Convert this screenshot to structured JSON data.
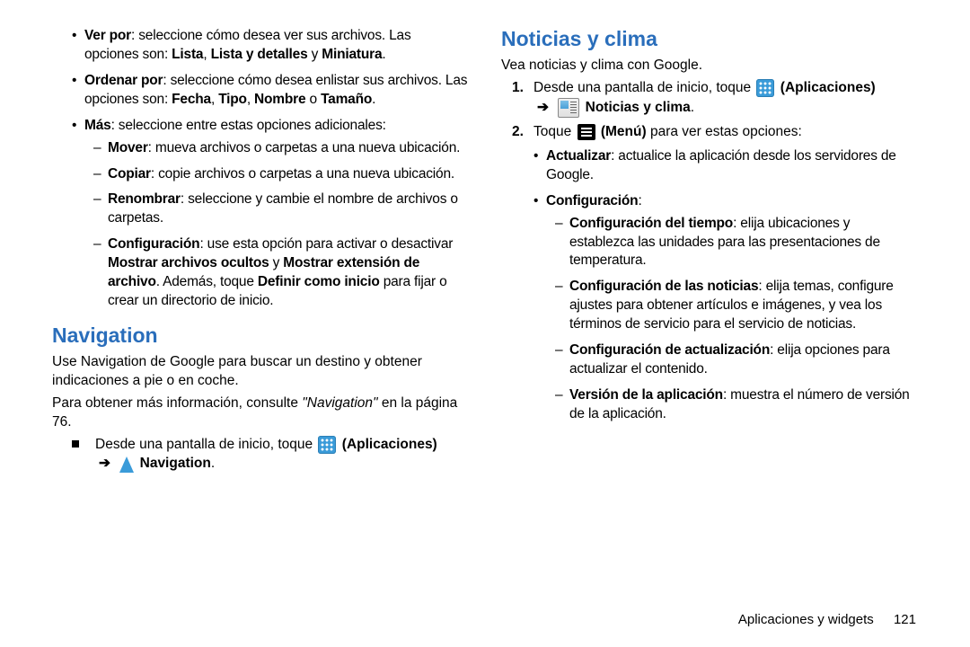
{
  "left": {
    "ver_por": {
      "label": "Ver por",
      "text": ": seleccione cómo desea ver sus archivos. Las opciones son: ",
      "opt1": "Lista",
      "sep1": ", ",
      "opt2": "Lista y detalles",
      "sep2": " y ",
      "opt3": "Miniatura",
      "tail": "."
    },
    "ordenar_por": {
      "label": "Ordenar por",
      "text": ": seleccione cómo desea enlistar sus archivos. Las opciones son: ",
      "opt1": "Fecha",
      "sep1": ", ",
      "opt2": "Tipo",
      "sep2": ", ",
      "opt3": "Nombre",
      "sep3": " o ",
      "opt4": "Tamaño",
      "tail": "."
    },
    "mas": {
      "label": "Más",
      "text": ": seleccione entre estas opciones adicionales:"
    },
    "mover": {
      "label": "Mover",
      "text": ": mueva archivos o carpetas a una nueva ubicación."
    },
    "copiar": {
      "label": "Copiar",
      "text": ": copie archivos o carpetas a una nueva ubicación."
    },
    "renombrar": {
      "label": "Renombrar",
      "text": ": seleccione y cambie el nombre de archivos o carpetas."
    },
    "config": {
      "label": "Configuración",
      "text1": ": use esta opción para activar o desactivar ",
      "b1": "Mostrar archivos ocultos",
      "y": " y ",
      "b2": "Mostrar extensión de archivo",
      "text2": ". Además, toque ",
      "b3": "Definir como inicio",
      "text3": " para fijar o crear un directorio de inicio."
    },
    "nav_title": "Navigation",
    "nav_p1": "Use Navigation de Google para buscar un destino y obtener indicaciones a pie o en coche.",
    "nav_p2a": "Para obtener más información, consulte ",
    "nav_p2b": "\"Navigation\"",
    "nav_p2c": " en la página 76.",
    "nav_step": {
      "pre": "Desde una pantalla de inicio, toque ",
      "apps": "(Aplicaciones)",
      "arrow": "➔",
      "name": "Navigation",
      "tail": "."
    }
  },
  "right": {
    "title": "Noticias y clima",
    "intro": "Vea noticias y clima con Google.",
    "step1": {
      "num": "1.",
      "pre": "Desde una pantalla de inicio, toque ",
      "apps": "(Aplicaciones)",
      "arrow": "➔",
      "name": "Noticias y clima",
      "tail": "."
    },
    "step2": {
      "num": "2.",
      "pre": "Toque ",
      "menu": "(Menú)",
      "post": " para ver estas opciones:"
    },
    "actualizar": {
      "label": "Actualizar",
      "text": ": actualice la aplicación desde los servidores de Google."
    },
    "config": {
      "label": "Configuración",
      "text": ":"
    },
    "cfg_tiempo": {
      "label": "Configuración del tiempo",
      "text": ": elija ubicaciones y establezca las unidades para las presentaciones de temperatura."
    },
    "cfg_noticias": {
      "label": "Configuración de las noticias",
      "text": ": elija temas, configure ajustes para obtener artículos e imágenes, y vea los términos de servicio para el servicio de noticias."
    },
    "cfg_actual": {
      "label": "Configuración de actualización",
      "text": ": elija opciones para actualizar el contenido."
    },
    "version": {
      "label": "Versión de la aplicación",
      "text": ": muestra el número de versión de la aplicación."
    }
  },
  "footer": {
    "section": "Aplicaciones y widgets",
    "page": "121"
  }
}
